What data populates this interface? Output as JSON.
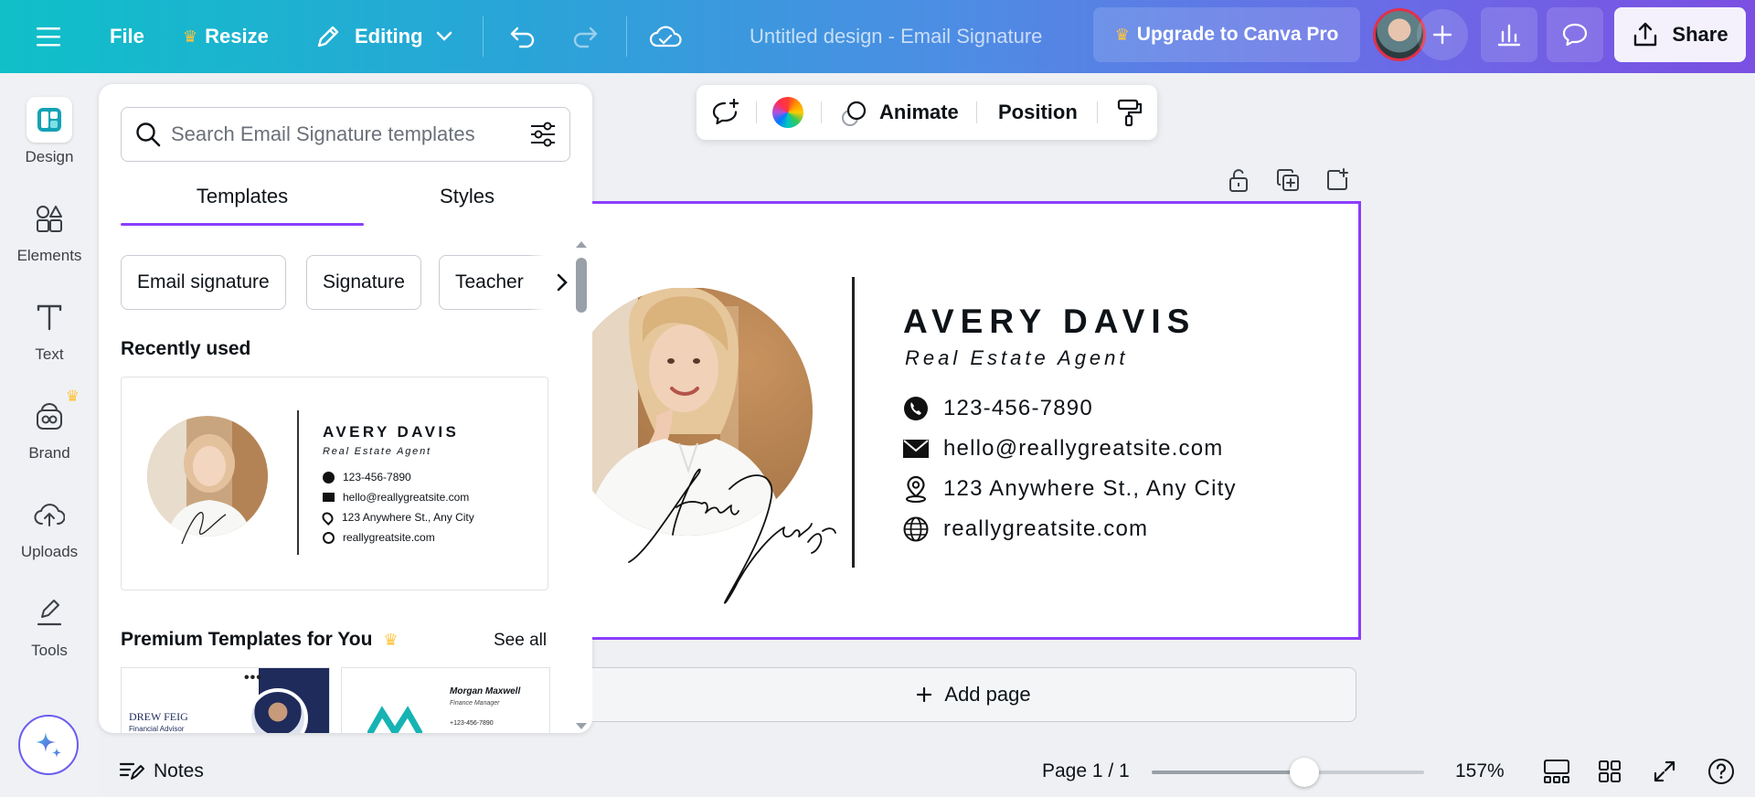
{
  "topbar": {
    "file": "File",
    "resize": "Resize",
    "editing": "Editing",
    "doc_title": "Untitled design - Email Signature",
    "upgrade": "Upgrade to Canva Pro",
    "share": "Share"
  },
  "rail": {
    "design": "Design",
    "elements": "Elements",
    "text": "Text",
    "brand": "Brand",
    "uploads": "Uploads",
    "tools": "Tools"
  },
  "panel": {
    "search_placeholder": "Search Email Signature templates",
    "tabs": [
      "Templates",
      "Styles"
    ],
    "chips": [
      "Email signature",
      "Signature",
      "Teacher"
    ],
    "recently_used": "Recently used",
    "premium_title": "Premium Templates for You",
    "see_all": "See all",
    "premium_1": {
      "name": "DREW FEIG",
      "role": "Financial Advisor"
    },
    "premium_2": {
      "name": "Morgan Maxwell",
      "role": "Finance Manager",
      "phone": "+123-456-7890"
    }
  },
  "context_toolbar": {
    "animate": "Animate",
    "position": "Position"
  },
  "signature": {
    "name": "AVERY DAVIS",
    "role": "Real Estate Agent",
    "phone": "123-456-7890",
    "email": "hello@reallygreatsite.com",
    "address": "123 Anywhere St., Any City",
    "website": "reallygreatsite.com"
  },
  "canvas": {
    "add_page": "Add page"
  },
  "bottombar": {
    "notes": "Notes",
    "page": "Page 1 / 1",
    "zoom": "157%",
    "zoom_slider_fraction": 0.56
  },
  "colors": {
    "accent": "#8b3dff",
    "crown": "#ffc53d"
  }
}
